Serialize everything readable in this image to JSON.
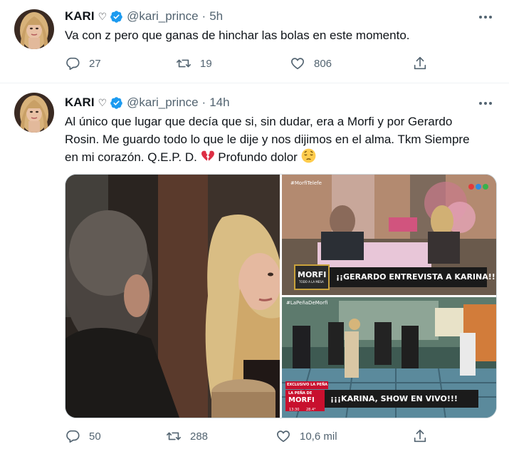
{
  "tweets": [
    {
      "author": {
        "name": "KARI",
        "name_suffix": "♡",
        "handle": "@kari_prince",
        "verified": true
      },
      "time": "5h",
      "separator": "·",
      "text": "Va con z pero que ganas de hinchar las bolas en este momento.",
      "stats": {
        "replies": "27",
        "retweets": "19",
        "likes": "806"
      }
    },
    {
      "author": {
        "name": "KARI",
        "name_suffix": "♡",
        "handle": "@kari_prince",
        "verified": true
      },
      "time": "14h",
      "separator": "·",
      "text_lines": [
        "Al único que lugar que decía que si, sin dudar, era a Morfi y por Gerardo",
        "Rosin. Me guardo todo lo que le dije y nos dijimos en el alma. Tkm Siempre",
        "en mi corazón. Q.E.P. D."
      ],
      "text_tail": "Profundo dolor",
      "emojis": [
        "broken-heart",
        "pensive-face"
      ],
      "media": {
        "top_right": {
          "logo": "MORFI",
          "logo_sub": "TODO A LA MESA",
          "caption": "¡¡GERARDO ENTREVISTA A KARINA!!",
          "tag": "#MorfiTelefe"
        },
        "bottom_right": {
          "badge": "EXCLUSIVO LA PEÑA",
          "logo_top": "LA PEÑA DE",
          "logo": "MORFI",
          "caption": "¡¡¡KARINA, SHOW EN VIVO!!!",
          "tag": "#LaPeñaDeMorfi",
          "clock": "13:30",
          "temp": "28.4°"
        }
      },
      "stats": {
        "replies": "50",
        "retweets": "288",
        "likes": "10,6 mil"
      }
    }
  ],
  "colors": {
    "accent": "#1d9bf0",
    "secondary_text": "#536471",
    "divider": "#eff3f4",
    "broken_heart": "#dd2e44"
  }
}
